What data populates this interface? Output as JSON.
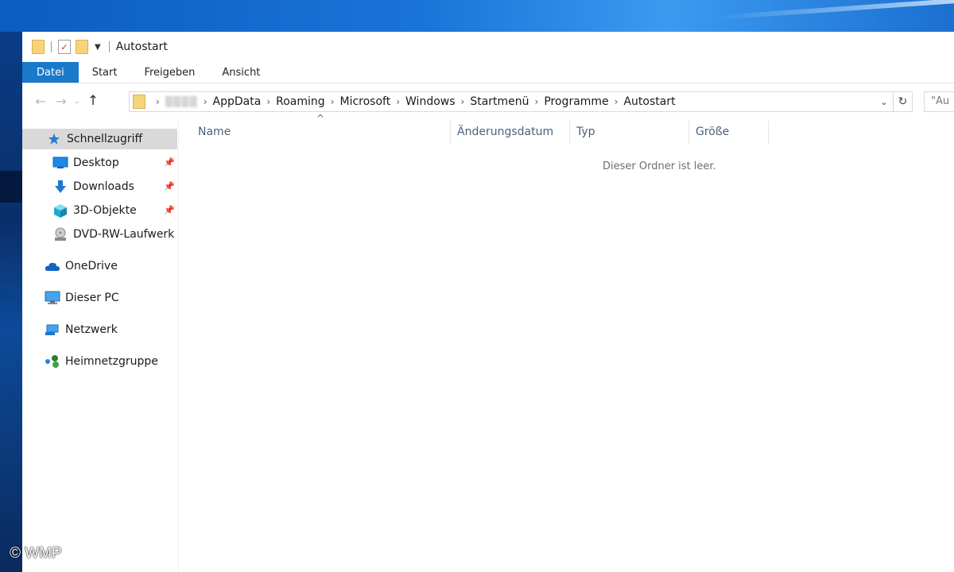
{
  "titlebar": {
    "title": "Autostart"
  },
  "ribbon": {
    "tabs": [
      "Datei",
      "Start",
      "Freigeben",
      "Ansicht"
    ]
  },
  "address": {
    "crumbs": [
      "AppData",
      "Roaming",
      "Microsoft",
      "Windows",
      "Startmenü",
      "Programme",
      "Autostart"
    ],
    "blurred_user": "▒▒▒▒"
  },
  "search": {
    "placeholder": "\"Au"
  },
  "nav": {
    "quick_access": "Schnellzugriff",
    "items": [
      "Desktop",
      "Downloads",
      "3D-Objekte",
      "DVD-RW-Laufwerk"
    ],
    "onedrive": "OneDrive",
    "thispc": "Dieser PC",
    "network": "Netzwerk",
    "homegroup": "Heimnetzgruppe"
  },
  "columns": [
    "Name",
    "Änderungsdatum",
    "Typ",
    "Größe"
  ],
  "content": {
    "empty_message": "Dieser Ordner ist leer."
  },
  "watermark": "© WMP",
  "colors": {
    "file_tab": "#1979ca",
    "selected_nav": "#d9d9d9",
    "folder": "#f6d57a"
  },
  "icons": [
    "folder-icon",
    "properties-icon",
    "back-arrow-icon",
    "forward-arrow-icon",
    "up-arrow-icon",
    "refresh-icon",
    "star-icon",
    "pin-icon",
    "desktop-icon",
    "download-icon",
    "cube-icon",
    "dvd-drive-icon",
    "cloud-icon",
    "computer-icon",
    "network-icon",
    "homegroup-icon"
  ]
}
